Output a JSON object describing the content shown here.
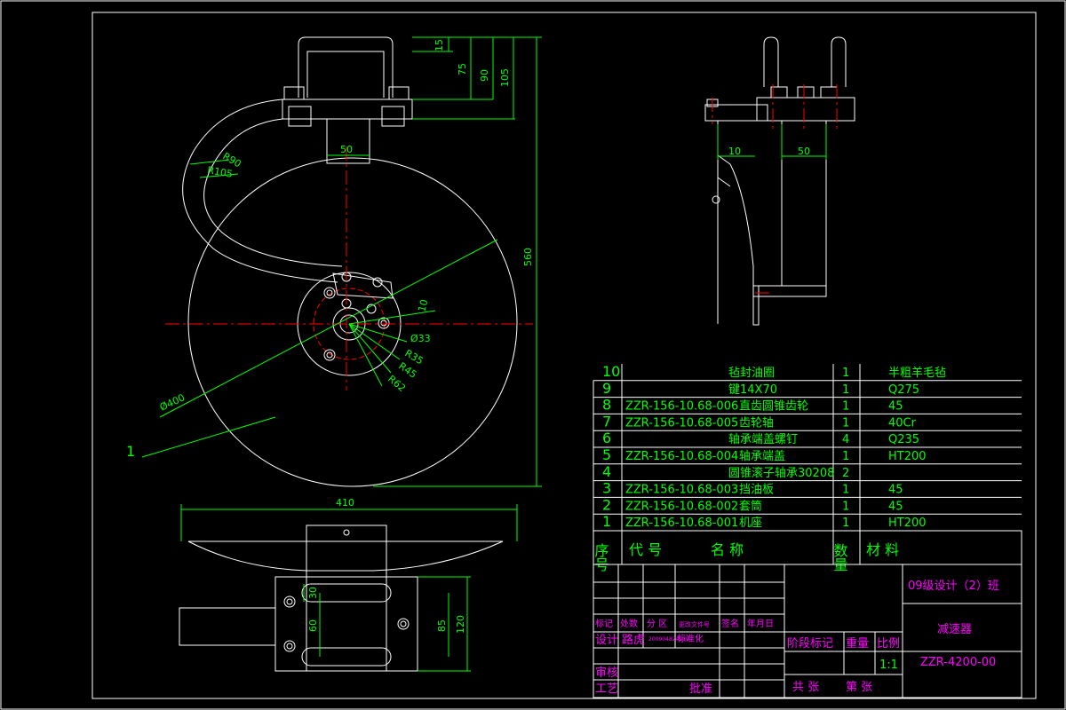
{
  "colors": {
    "background": "#000000",
    "outline": "#ffffff",
    "dimension": "#00ff00",
    "centerline": "#ff0000",
    "title_accent": "#ff00ff",
    "table_line": "#ffffff"
  },
  "main_view": {
    "dims": {
      "d15": "15",
      "d75": "75",
      "d90": "90",
      "d105": "105",
      "d560": "560",
      "d50": "50",
      "r90": "R90",
      "r105": "R105",
      "d10": "10",
      "phi33": "Ø33",
      "r35": "R35",
      "r45": "R45",
      "r62": "R62",
      "phi400": "Ø400"
    },
    "leader_label": "1"
  },
  "side_view": {
    "dims": {
      "d10": "10",
      "d50": "50"
    }
  },
  "bottom_view": {
    "dims": {
      "d410": "410",
      "d30": "30",
      "d60": "60",
      "d85": "85",
      "d120": "120"
    }
  },
  "parts_table": {
    "rows": [
      {
        "no": "10",
        "code": "",
        "name": "毡封油圈",
        "qty": "1",
        "material": "半粗羊毛毡"
      },
      {
        "no": "9",
        "code": "",
        "name": "键14X70",
        "qty": "1",
        "material": "Q275"
      },
      {
        "no": "8",
        "code": "ZZR-156-10.68-006",
        "name": "直齿圆锥齿轮",
        "qty": "1",
        "material": "45"
      },
      {
        "no": "7",
        "code": "ZZR-156-10.68-005",
        "name": "齿轮轴",
        "qty": "1",
        "material": "40Cr"
      },
      {
        "no": "6",
        "code": "",
        "name": "轴承端盖螺钉",
        "qty": "4",
        "material": "Q235"
      },
      {
        "no": "5",
        "code": "ZZR-156-10.68-004",
        "name": "轴承端盖",
        "qty": "1",
        "material": "HT200"
      },
      {
        "no": "4",
        "code": "",
        "name": "圆锥滚子轴承30208",
        "qty": "2",
        "material": ""
      },
      {
        "no": "3",
        "code": "ZZR-156-10.68-003",
        "name": "挡油板",
        "qty": "1",
        "material": "45"
      },
      {
        "no": "2",
        "code": "ZZR-156-10.68-002",
        "name": "套筒",
        "qty": "1",
        "material": "45"
      },
      {
        "no": "1",
        "code": "ZZR-156-10.68-001",
        "name": "机座",
        "qty": "1",
        "material": "HT200"
      }
    ],
    "header": {
      "seq": "序号",
      "code": "代  号",
      "name": "名  称",
      "qty": "数量",
      "material": "材  料"
    }
  },
  "title_block": {
    "class_name": "09级设计（2）班",
    "title": "减速器",
    "drawing_no": "ZZR-4200-00",
    "mark": "标记",
    "count": "处数",
    "zone": "分  区",
    "change_doc": "更改文件号",
    "sign": "签名",
    "date": "年月日",
    "design": "设计",
    "designer": "路虎",
    "designer_id": "200904824239",
    "standardize": "标准化",
    "stage_mark": "阶段标记",
    "weight": "重量",
    "scale": "比例",
    "scale_value": "1:1",
    "review": "审核",
    "process": "工艺",
    "approve": "批准",
    "sheets_total": "共  张",
    "sheet_no": "第  张"
  }
}
